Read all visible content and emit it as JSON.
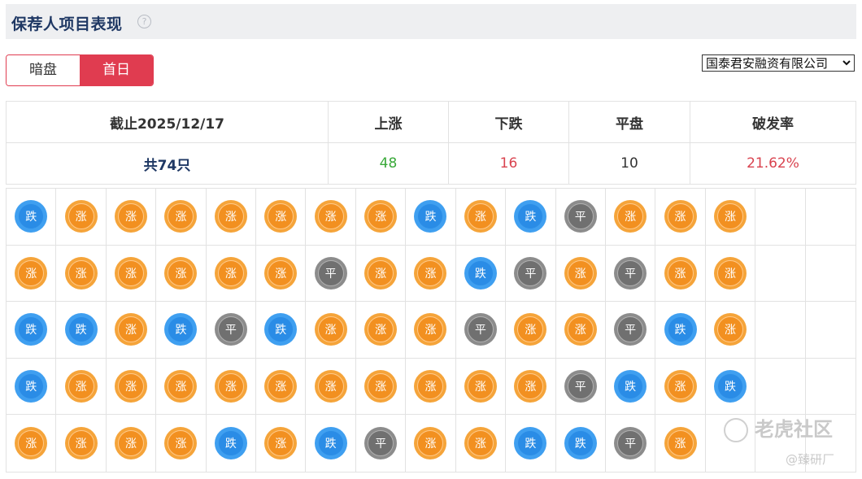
{
  "header": {
    "title": "保荐人项目表现",
    "help_icon": "?"
  },
  "toggle": {
    "tabs": [
      {
        "label": "暗盘",
        "active": false
      },
      {
        "label": "首日",
        "active": true
      }
    ]
  },
  "sponsor_select": {
    "value": "国泰君安融资有限公司"
  },
  "summary": {
    "headers": [
      "截止2025/12/17",
      "上涨",
      "下跌",
      "平盘",
      "破发率"
    ],
    "values": [
      "共74只",
      "48",
      "16",
      "10",
      "21.62%"
    ]
  },
  "legend_labels": {
    "up": "涨",
    "down": "跌",
    "flat": "平"
  },
  "grid": {
    "rows": [
      [
        "down",
        "up",
        "up",
        "up",
        "up",
        "up",
        "up",
        "up",
        "down",
        "up",
        "down",
        "flat",
        "up",
        "up",
        "up",
        "",
        ""
      ],
      [
        "up",
        "up",
        "up",
        "up",
        "up",
        "up",
        "flat",
        "up",
        "up",
        "down",
        "flat",
        "up",
        "flat",
        "up",
        "up",
        "",
        ""
      ],
      [
        "down",
        "down",
        "up",
        "down",
        "flat",
        "down",
        "up",
        "up",
        "up",
        "flat",
        "up",
        "up",
        "flat",
        "down",
        "up",
        "",
        ""
      ],
      [
        "down",
        "up",
        "up",
        "up",
        "up",
        "up",
        "up",
        "up",
        "up",
        "up",
        "up",
        "flat",
        "down",
        "up",
        "down",
        "",
        ""
      ],
      [
        "up",
        "up",
        "up",
        "up",
        "down",
        "up",
        "down",
        "flat",
        "up",
        "up",
        "down",
        "down",
        "flat",
        "up",
        "",
        "",
        ""
      ]
    ]
  },
  "colors": {
    "accent": "#e03c50",
    "up": "#f29020",
    "down": "#2a8ce6",
    "flat": "#707070"
  },
  "watermark": {
    "main": "老虎社区",
    "sub": "@臻研厂"
  }
}
